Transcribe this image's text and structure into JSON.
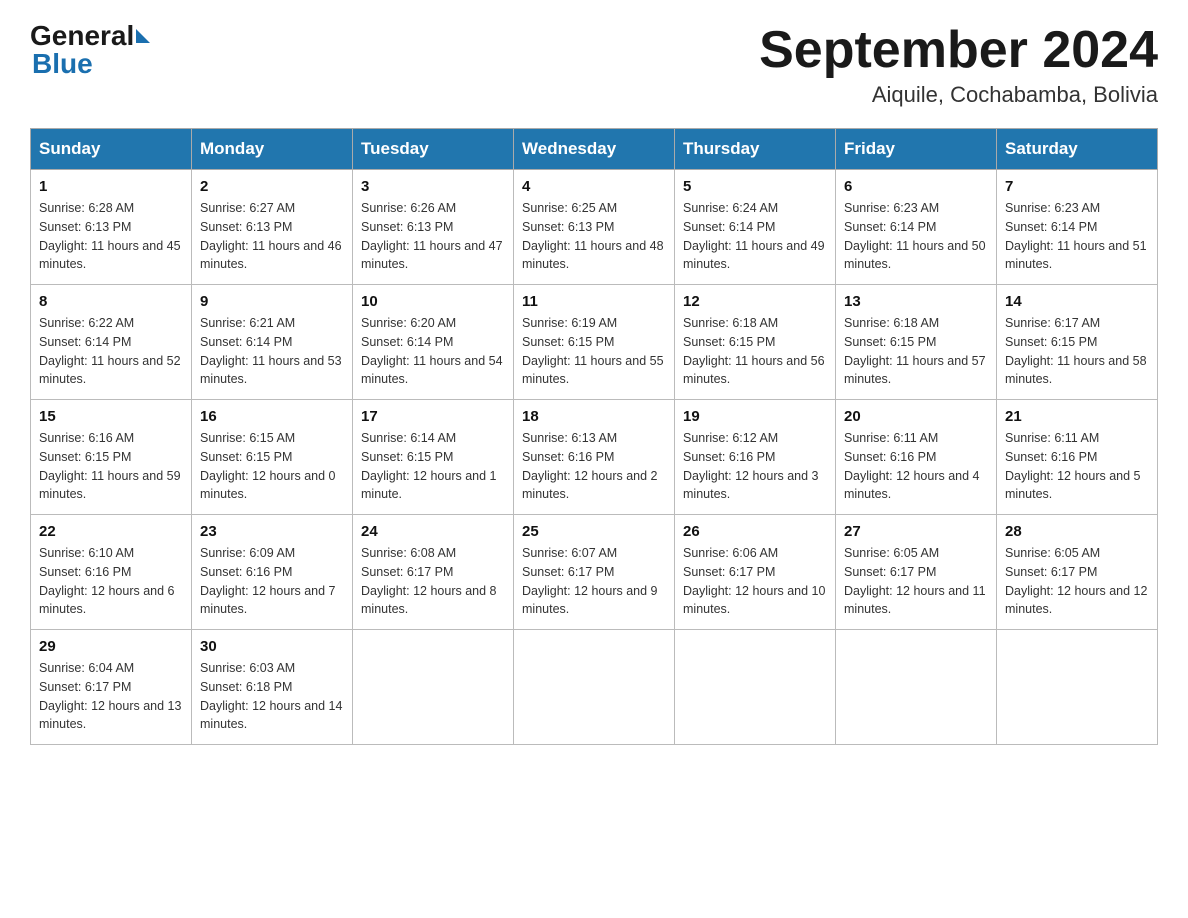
{
  "header": {
    "logo_general": "General",
    "logo_blue": "Blue",
    "month_title": "September 2024",
    "location": "Aiquile, Cochabamba, Bolivia"
  },
  "weekdays": [
    "Sunday",
    "Monday",
    "Tuesday",
    "Wednesday",
    "Thursday",
    "Friday",
    "Saturday"
  ],
  "weeks": [
    [
      {
        "day": "1",
        "sunrise": "6:28 AM",
        "sunset": "6:13 PM",
        "daylight": "11 hours and 45 minutes."
      },
      {
        "day": "2",
        "sunrise": "6:27 AM",
        "sunset": "6:13 PM",
        "daylight": "11 hours and 46 minutes."
      },
      {
        "day": "3",
        "sunrise": "6:26 AM",
        "sunset": "6:13 PM",
        "daylight": "11 hours and 47 minutes."
      },
      {
        "day": "4",
        "sunrise": "6:25 AM",
        "sunset": "6:13 PM",
        "daylight": "11 hours and 48 minutes."
      },
      {
        "day": "5",
        "sunrise": "6:24 AM",
        "sunset": "6:14 PM",
        "daylight": "11 hours and 49 minutes."
      },
      {
        "day": "6",
        "sunrise": "6:23 AM",
        "sunset": "6:14 PM",
        "daylight": "11 hours and 50 minutes."
      },
      {
        "day": "7",
        "sunrise": "6:23 AM",
        "sunset": "6:14 PM",
        "daylight": "11 hours and 51 minutes."
      }
    ],
    [
      {
        "day": "8",
        "sunrise": "6:22 AM",
        "sunset": "6:14 PM",
        "daylight": "11 hours and 52 minutes."
      },
      {
        "day": "9",
        "sunrise": "6:21 AM",
        "sunset": "6:14 PM",
        "daylight": "11 hours and 53 minutes."
      },
      {
        "day": "10",
        "sunrise": "6:20 AM",
        "sunset": "6:14 PM",
        "daylight": "11 hours and 54 minutes."
      },
      {
        "day": "11",
        "sunrise": "6:19 AM",
        "sunset": "6:15 PM",
        "daylight": "11 hours and 55 minutes."
      },
      {
        "day": "12",
        "sunrise": "6:18 AM",
        "sunset": "6:15 PM",
        "daylight": "11 hours and 56 minutes."
      },
      {
        "day": "13",
        "sunrise": "6:18 AM",
        "sunset": "6:15 PM",
        "daylight": "11 hours and 57 minutes."
      },
      {
        "day": "14",
        "sunrise": "6:17 AM",
        "sunset": "6:15 PM",
        "daylight": "11 hours and 58 minutes."
      }
    ],
    [
      {
        "day": "15",
        "sunrise": "6:16 AM",
        "sunset": "6:15 PM",
        "daylight": "11 hours and 59 minutes."
      },
      {
        "day": "16",
        "sunrise": "6:15 AM",
        "sunset": "6:15 PM",
        "daylight": "12 hours and 0 minutes."
      },
      {
        "day": "17",
        "sunrise": "6:14 AM",
        "sunset": "6:15 PM",
        "daylight": "12 hours and 1 minute."
      },
      {
        "day": "18",
        "sunrise": "6:13 AM",
        "sunset": "6:16 PM",
        "daylight": "12 hours and 2 minutes."
      },
      {
        "day": "19",
        "sunrise": "6:12 AM",
        "sunset": "6:16 PM",
        "daylight": "12 hours and 3 minutes."
      },
      {
        "day": "20",
        "sunrise": "6:11 AM",
        "sunset": "6:16 PM",
        "daylight": "12 hours and 4 minutes."
      },
      {
        "day": "21",
        "sunrise": "6:11 AM",
        "sunset": "6:16 PM",
        "daylight": "12 hours and 5 minutes."
      }
    ],
    [
      {
        "day": "22",
        "sunrise": "6:10 AM",
        "sunset": "6:16 PM",
        "daylight": "12 hours and 6 minutes."
      },
      {
        "day": "23",
        "sunrise": "6:09 AM",
        "sunset": "6:16 PM",
        "daylight": "12 hours and 7 minutes."
      },
      {
        "day": "24",
        "sunrise": "6:08 AM",
        "sunset": "6:17 PM",
        "daylight": "12 hours and 8 minutes."
      },
      {
        "day": "25",
        "sunrise": "6:07 AM",
        "sunset": "6:17 PM",
        "daylight": "12 hours and 9 minutes."
      },
      {
        "day": "26",
        "sunrise": "6:06 AM",
        "sunset": "6:17 PM",
        "daylight": "12 hours and 10 minutes."
      },
      {
        "day": "27",
        "sunrise": "6:05 AM",
        "sunset": "6:17 PM",
        "daylight": "12 hours and 11 minutes."
      },
      {
        "day": "28",
        "sunrise": "6:05 AM",
        "sunset": "6:17 PM",
        "daylight": "12 hours and 12 minutes."
      }
    ],
    [
      {
        "day": "29",
        "sunrise": "6:04 AM",
        "sunset": "6:17 PM",
        "daylight": "12 hours and 13 minutes."
      },
      {
        "day": "30",
        "sunrise": "6:03 AM",
        "sunset": "6:18 PM",
        "daylight": "12 hours and 14 minutes."
      },
      null,
      null,
      null,
      null,
      null
    ]
  ],
  "labels": {
    "sunrise": "Sunrise:",
    "sunset": "Sunset:",
    "daylight": "Daylight:"
  }
}
